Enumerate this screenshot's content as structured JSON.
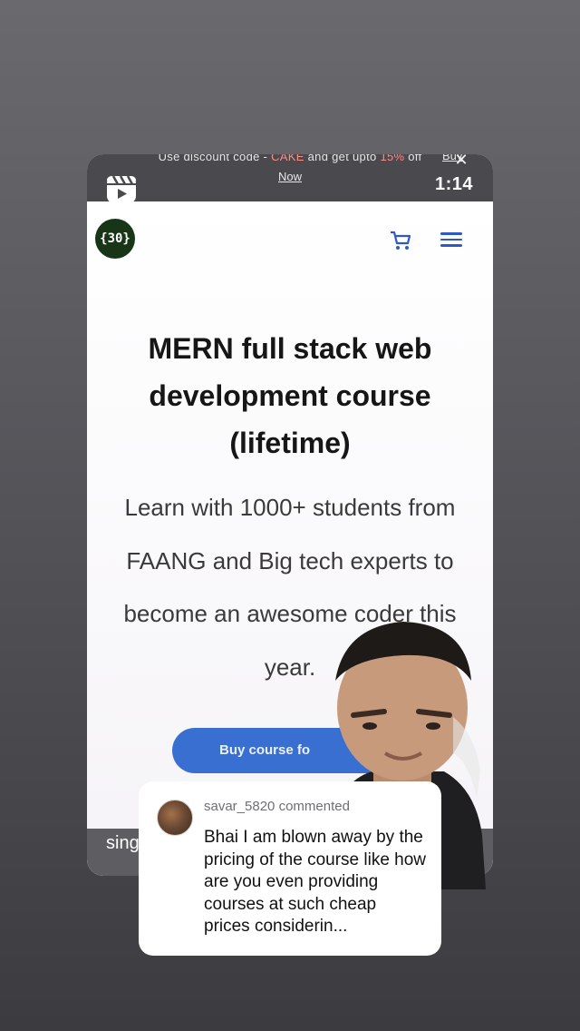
{
  "promo_banner": {
    "text_before": "Use discount code - ",
    "code": "CAKE",
    "text_middle": " and get upto ",
    "discount": "15%",
    "text_after": " off",
    "buy_label": "Buy",
    "now_label": "Now"
  },
  "story": {
    "timer": "1:14"
  },
  "site": {
    "logo_text": "{30}",
    "headline_lines": [
      "MERN full stack web",
      "development course",
      "(lifetime)"
    ],
    "subtitle_lines": [
      "Learn with 1000+ students from",
      "FAANG and Big tech experts to",
      "become an awesome coder this",
      "year."
    ],
    "cta_label": "Buy course fo"
  },
  "bottom_caption": "sing",
  "comment": {
    "username": "savar_5820",
    "action": "commented",
    "text": "Bhai I am blown away by the pricing of the course like how are you even providing courses at such cheap prices considerin..."
  },
  "colors": {
    "cta": "#3a6fd2",
    "logo_bg": "#183517",
    "menu_icon": "#2f58c7"
  }
}
